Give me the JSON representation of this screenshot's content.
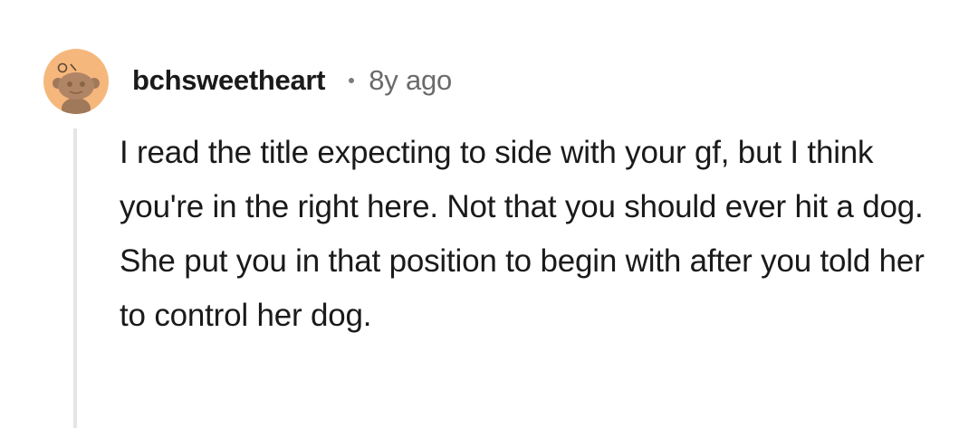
{
  "comment": {
    "author": "bchsweetheart",
    "separator_icon": "dot-separator",
    "time_ago": "8y ago",
    "avatar_icon": "snoo-avatar-icon",
    "avatar_color": "#f6b77c",
    "body": "I read the title expecting to side with your gf, but I think you're in the right here. Not that you should ever hit a dog. She put you in that position to begin with after you told her to control her dog."
  }
}
